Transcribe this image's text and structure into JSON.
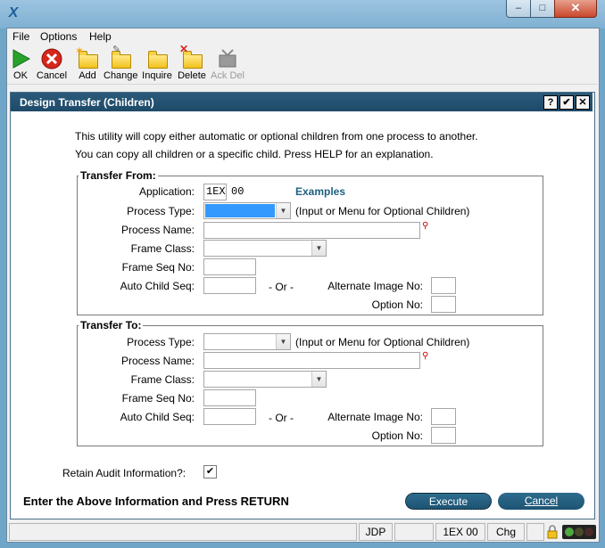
{
  "window": {
    "minimize_glyph": "‒",
    "maximize_glyph": "□",
    "close_glyph": "✕"
  },
  "menu": [
    "File",
    "Options",
    "Help"
  ],
  "toolbar": {
    "ok": "OK",
    "cancel": "Cancel",
    "add": "Add",
    "change": "Change",
    "inquire": "Inquire",
    "delete": "Delete",
    "ack_del": "Ack Del"
  },
  "dialog": {
    "title": "Design Transfer (Children)",
    "help_glyph": "?",
    "check_glyph": "✔",
    "close_glyph": "✕",
    "intro_line1": "This utility will copy either automatic or optional children from one process to another.",
    "intro_line2": "You can copy all children or a specific child. Press HELP for an explanation."
  },
  "transfer_from": {
    "title": "Transfer From:",
    "application_label": "Application:",
    "application_value": "1EX",
    "application_version": "00",
    "examples_link": "Examples",
    "process_type_label": "Process Type:",
    "process_type_note": "(Input or Menu for Optional Children)",
    "process_name_label": "Process Name:",
    "frame_class_label": "Frame Class:",
    "frame_seq_label": "Frame Seq No:",
    "auto_child_label": "Auto Child Seq:",
    "or_text": "- Or -",
    "alt_image_label": "Alternate Image No:",
    "option_label": "Option No:"
  },
  "transfer_to": {
    "title": "Transfer To:",
    "process_type_label": "Process Type:",
    "process_type_note": "(Input or Menu for Optional Children)",
    "process_name_label": "Process Name:",
    "frame_class_label": "Frame Class:",
    "frame_seq_label": "Frame Seq No:",
    "auto_child_label": "Auto Child Seq:",
    "or_text": "- Or -",
    "alt_image_label": "Alternate Image No:",
    "option_label": "Option No:"
  },
  "retain_audit": {
    "label": "Retain Audit Information?:",
    "checked": true,
    "check_glyph": "✔"
  },
  "footer": {
    "instruction": "Enter the Above Information and Press RETURN",
    "execute": "Execute",
    "cancel": "Cancel"
  },
  "status": {
    "user": "JDP",
    "app": "1EX 00",
    "mode": "Chg"
  },
  "colors": {
    "dialog_title_bg": "#1e4a69",
    "button_bg": "#1d5373",
    "link": "#1f5f7f"
  }
}
